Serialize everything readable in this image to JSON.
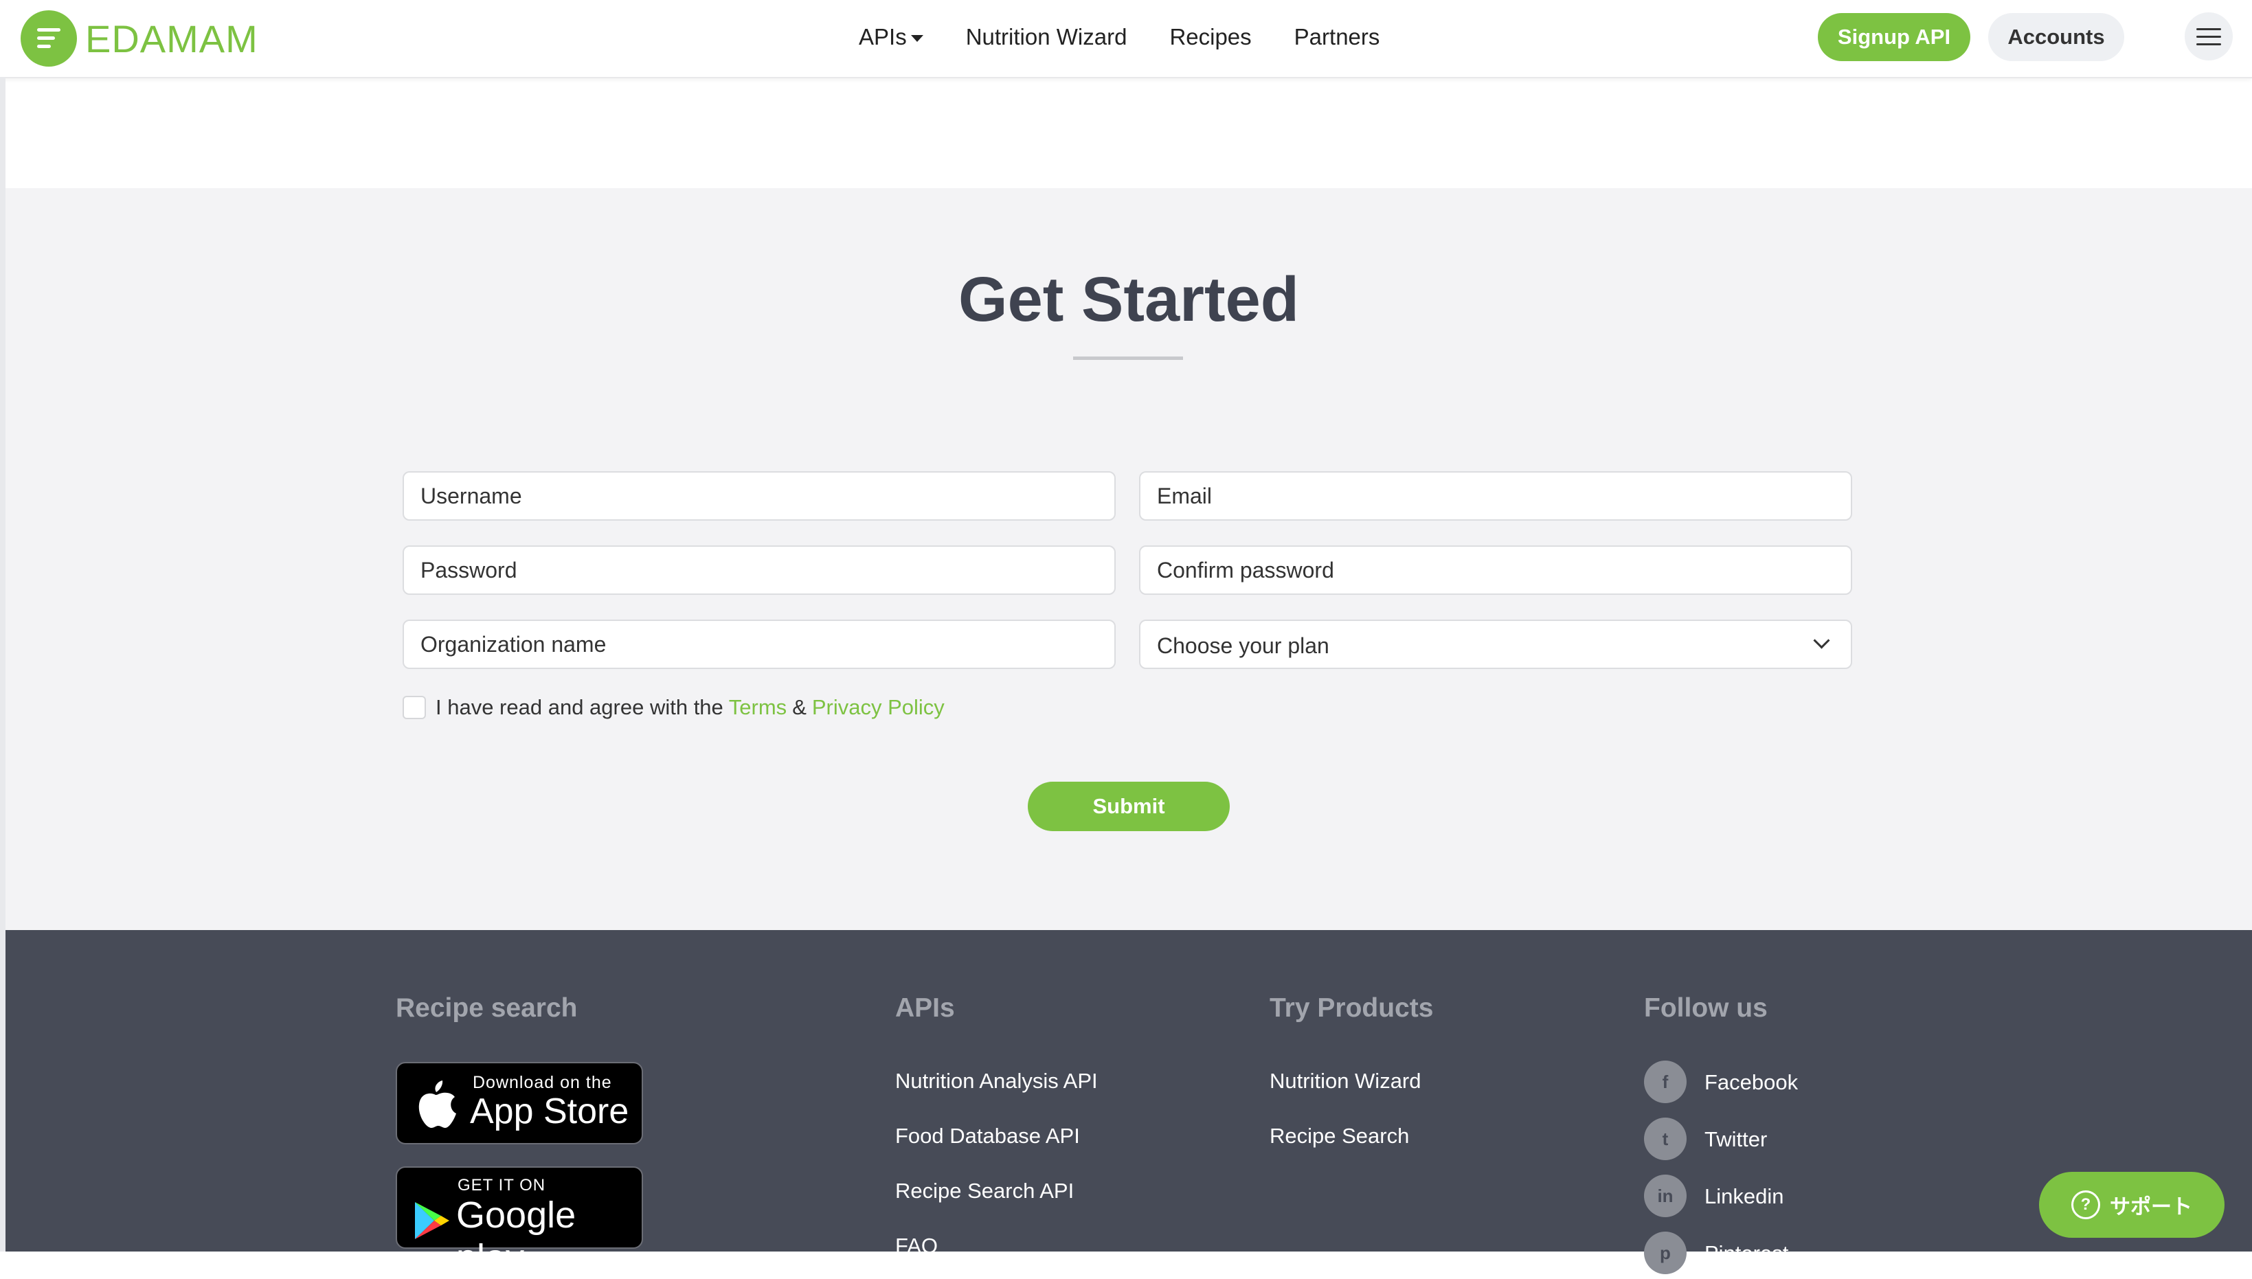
{
  "header": {
    "logo_text": "EDAMAM",
    "nav": [
      {
        "label": "APIs"
      },
      {
        "label": "Nutrition Wizard"
      },
      {
        "label": "Recipes"
      },
      {
        "label": "Partners"
      }
    ],
    "signup_label": "Signup API",
    "accounts_label": "Accounts"
  },
  "form": {
    "title": "Get Started",
    "username_placeholder": "Username",
    "email_placeholder": "Email",
    "password_placeholder": "Password",
    "confirm_password_placeholder": "Confirm password",
    "organization_placeholder": "Organization name",
    "plan_select_value": "Choose your plan",
    "agree_text": "I have read and agree with the",
    "terms_label": "Terms",
    "ampersand": "&",
    "privacy_label": "Privacy Policy",
    "submit_label": "Submit"
  },
  "footer": {
    "recipe_search": {
      "heading": "Recipe search",
      "app_store_small": "Download on the",
      "app_store_big": "App Store",
      "google_small": "GET IT ON",
      "google_big": "Google play"
    },
    "apis": {
      "heading": "APIs",
      "links": [
        "Nutrition Analysis API",
        "Food Database API",
        "Recipe Search API",
        "FAQ"
      ]
    },
    "products": {
      "heading": "Try Products",
      "links": [
        "Nutrition Wizard",
        "Recipe Search"
      ]
    },
    "follow": {
      "heading": "Follow us",
      "links": [
        {
          "label": "Facebook",
          "icon": "f"
        },
        {
          "label": "Twitter",
          "icon": "t"
        },
        {
          "label": "Linkedin",
          "icon": "in"
        },
        {
          "label": "Pinterest",
          "icon": "p"
        }
      ]
    }
  },
  "support_label": "サポート",
  "colors": {
    "accent": "#7dc242",
    "footer_bg": "#474b57",
    "section_bg": "#f3f3f5"
  }
}
